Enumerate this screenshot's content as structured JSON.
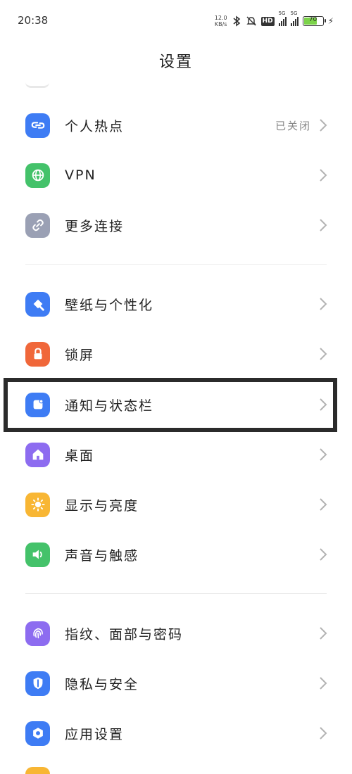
{
  "status_bar": {
    "time": "20:38",
    "net_speed_value": "12.0",
    "net_speed_unit": "KB/s",
    "hd_label": "HD",
    "signal1_label": "5G",
    "signal2_label": "5G",
    "battery_percent": "70"
  },
  "page": {
    "title": "设置"
  },
  "items": [
    {
      "label": "个人热点",
      "value": "已关闭",
      "icon": "hotspot-icon",
      "color": "#3e7cf4"
    },
    {
      "label": "VPN",
      "icon": "globe-icon",
      "color": "#44c26a"
    },
    {
      "label": "更多连接",
      "icon": "link-icon",
      "color": "#9aa0b4"
    },
    {
      "label": "壁纸与个性化",
      "icon": "brush-icon",
      "color": "#3e7cf4"
    },
    {
      "label": "锁屏",
      "icon": "lock-icon",
      "color": "#f0673a"
    },
    {
      "label": "通知与状态栏",
      "icon": "notification-icon",
      "color": "#3e7cf4"
    },
    {
      "label": "桌面",
      "icon": "home-icon",
      "color": "#8d6cf0"
    },
    {
      "label": "显示与亮度",
      "icon": "sun-icon",
      "color": "#f8b634"
    },
    {
      "label": "声音与触感",
      "icon": "speaker-icon",
      "color": "#44c26a"
    },
    {
      "label": "指纹、面部与密码",
      "icon": "fingerprint-icon",
      "color": "#8d6cf0"
    },
    {
      "label": "隐私与安全",
      "icon": "shield-icon",
      "color": "#3e7cf4"
    },
    {
      "label": "应用设置",
      "icon": "app-settings-icon",
      "color": "#3e7cf4"
    }
  ],
  "highlighted_item": "通知与状态栏"
}
